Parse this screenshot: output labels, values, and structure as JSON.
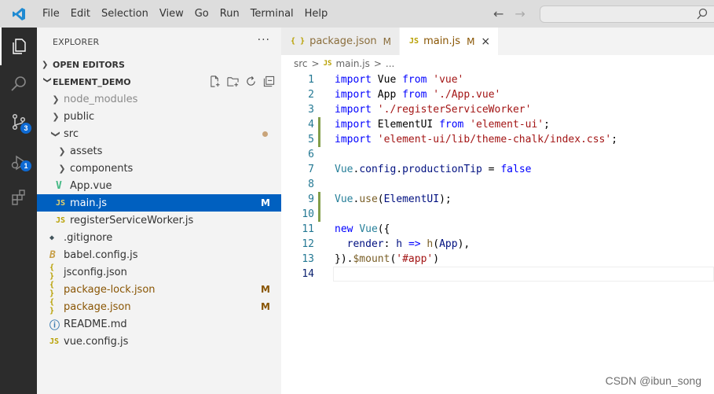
{
  "menu": [
    "File",
    "Edit",
    "Selection",
    "View",
    "Go",
    "Run",
    "Terminal",
    "Help"
  ],
  "activity_badges": {
    "source_control": "3",
    "run_debug": "1"
  },
  "explorer": {
    "title": "EXPLORER",
    "more": "···",
    "open_editors": "OPEN EDITORS",
    "project": "ELEMENT_DEMO",
    "tree": [
      {
        "label": "node_modules",
        "kind": "folder",
        "open": false,
        "level": 0,
        "muted": true,
        "status": ""
      },
      {
        "label": "public",
        "kind": "folder",
        "open": false,
        "level": 0,
        "status": ""
      },
      {
        "label": "src",
        "kind": "folder",
        "open": true,
        "level": 0,
        "status": "dot"
      },
      {
        "label": "assets",
        "kind": "folder",
        "open": false,
        "level": 1,
        "status": ""
      },
      {
        "label": "components",
        "kind": "folder",
        "open": false,
        "level": 1,
        "status": ""
      },
      {
        "label": "App.vue",
        "kind": "vue",
        "level": 1,
        "status": ""
      },
      {
        "label": "main.js",
        "kind": "js",
        "level": 1,
        "status": "M",
        "selected": true
      },
      {
        "label": "registerServiceWorker.js",
        "kind": "js",
        "level": 1,
        "status": ""
      },
      {
        "label": ".gitignore",
        "kind": "git",
        "level": 0,
        "status": ""
      },
      {
        "label": "babel.config.js",
        "kind": "babel",
        "level": 0,
        "status": ""
      },
      {
        "label": "jsconfig.json",
        "kind": "json",
        "level": 0,
        "status": ""
      },
      {
        "label": "package-lock.json",
        "kind": "json",
        "level": 0,
        "status": "M",
        "modified": true
      },
      {
        "label": "package.json",
        "kind": "json",
        "level": 0,
        "status": "M",
        "modified": true
      },
      {
        "label": "README.md",
        "kind": "info",
        "level": 0,
        "status": ""
      },
      {
        "label": "vue.config.js",
        "kind": "js",
        "level": 0,
        "status": ""
      }
    ]
  },
  "tabs": [
    {
      "icon": "{ }",
      "label": "package.json",
      "status": "M",
      "active": false
    },
    {
      "icon": "JS",
      "label": "main.js",
      "status": "M",
      "active": true,
      "close": "×"
    }
  ],
  "breadcrumb": {
    "folder": "src",
    "sep1": ">",
    "icon": "JS",
    "file": "main.js",
    "sep2": ">",
    "tail": "..."
  },
  "code": [
    {
      "n": "1",
      "mark": false,
      "tokens": [
        [
          "kw",
          "import"
        ],
        [
          "plain",
          " Vue "
        ],
        [
          "kw",
          "from"
        ],
        [
          "plain",
          " "
        ],
        [
          "str",
          "'vue'"
        ]
      ]
    },
    {
      "n": "2",
      "mark": false,
      "tokens": [
        [
          "kw",
          "import"
        ],
        [
          "plain",
          " App "
        ],
        [
          "kw",
          "from"
        ],
        [
          "plain",
          " "
        ],
        [
          "str",
          "'./App.vue'"
        ]
      ]
    },
    {
      "n": "3",
      "mark": false,
      "tokens": [
        [
          "kw",
          "import"
        ],
        [
          "plain",
          " "
        ],
        [
          "str",
          "'./registerServiceWorker'"
        ]
      ]
    },
    {
      "n": "4",
      "mark": true,
      "tokens": [
        [
          "kw",
          "import"
        ],
        [
          "plain",
          " ElementUI "
        ],
        [
          "kw",
          "from"
        ],
        [
          "plain",
          " "
        ],
        [
          "str",
          "'element-ui'"
        ],
        [
          "plain",
          ";"
        ]
      ]
    },
    {
      "n": "5",
      "mark": true,
      "tokens": [
        [
          "kw",
          "import"
        ],
        [
          "plain",
          " "
        ],
        [
          "str",
          "'element-ui/lib/theme-chalk/index.css'"
        ],
        [
          "plain",
          ";"
        ]
      ]
    },
    {
      "n": "6",
      "mark": false,
      "tokens": []
    },
    {
      "n": "7",
      "mark": false,
      "tokens": [
        [
          "cls",
          "Vue"
        ],
        [
          "plain",
          "."
        ],
        [
          "id",
          "config"
        ],
        [
          "plain",
          "."
        ],
        [
          "id",
          "productionTip"
        ],
        [
          "plain",
          " = "
        ],
        [
          "kw",
          "false"
        ]
      ]
    },
    {
      "n": "8",
      "mark": false,
      "tokens": []
    },
    {
      "n": "9",
      "mark": true,
      "tokens": [
        [
          "cls",
          "Vue"
        ],
        [
          "plain",
          "."
        ],
        [
          "fn",
          "use"
        ],
        [
          "plain",
          "("
        ],
        [
          "id",
          "ElementUI"
        ],
        [
          "plain",
          ");"
        ]
      ]
    },
    {
      "n": "10",
      "mark": true,
      "tokens": []
    },
    {
      "n": "11",
      "mark": false,
      "tokens": [
        [
          "kw",
          "new"
        ],
        [
          "plain",
          " "
        ],
        [
          "cls",
          "Vue"
        ],
        [
          "plain",
          "({"
        ]
      ]
    },
    {
      "n": "12",
      "mark": false,
      "tokens": [
        [
          "plain",
          "  "
        ],
        [
          "id",
          "render"
        ],
        [
          "plain",
          ": "
        ],
        [
          "id",
          "h"
        ],
        [
          "plain",
          " "
        ],
        [
          "kw",
          "=>"
        ],
        [
          "plain",
          " "
        ],
        [
          "fn",
          "h"
        ],
        [
          "plain",
          "("
        ],
        [
          "id",
          "App"
        ],
        [
          "plain",
          "),"
        ]
      ]
    },
    {
      "n": "13",
      "mark": false,
      "tokens": [
        [
          "plain",
          "})."
        ],
        [
          "fn",
          "$mount"
        ],
        [
          "plain",
          "("
        ],
        [
          "str",
          "'#app'"
        ],
        [
          "plain",
          ")"
        ]
      ]
    },
    {
      "n": "14",
      "mark": false,
      "tokens": [],
      "current": true
    }
  ],
  "watermark": "CSDN @ibun_song"
}
